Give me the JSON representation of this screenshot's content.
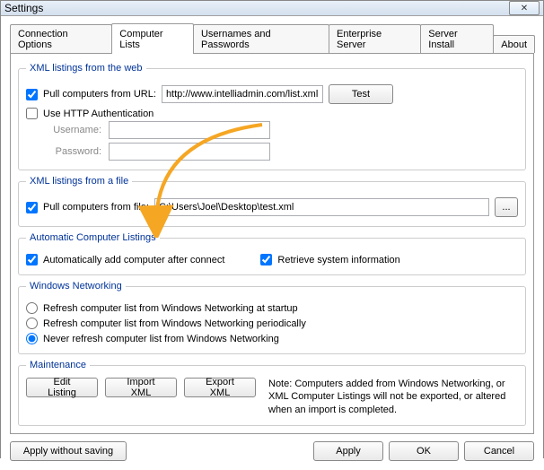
{
  "window": {
    "title": "Settings",
    "close_glyph": "✕"
  },
  "tabs": {
    "connection_options": "Connection Options",
    "computer_lists": "Computer Lists",
    "usernames_passwords": "Usernames and Passwords",
    "enterprise_server": "Enterprise Server",
    "server_install": "Server Install",
    "about": "About"
  },
  "web": {
    "legend": "XML listings from the web",
    "pull_label": "Pull computers from URL:",
    "url_value": "http://www.intelliadmin.com/list.xml",
    "test_label": "Test",
    "http_auth_label": "Use HTTP Authentication",
    "username_label": "Username:",
    "password_label": "Password:"
  },
  "file": {
    "legend": "XML listings from a file",
    "pull_label": "Pull computers from file:",
    "path_value": "C:\\Users\\Joel\\Desktop\\test.xml",
    "browse_label": "..."
  },
  "auto": {
    "legend": "Automatic Computer Listings",
    "add_label": "Automatically add computer after connect",
    "retrieve_label": "Retrieve system information"
  },
  "net": {
    "legend": "Windows Networking",
    "opt_startup": "Refresh computer list from Windows Networking at startup",
    "opt_periodic": "Refresh computer list from Windows Networking periodically",
    "opt_never": "Never refresh computer list from Windows Networking"
  },
  "maint": {
    "legend": "Maintenance",
    "edit_label": "Edit Listing",
    "import_label": "Import XML",
    "export_label": "Export XML",
    "note": "Note: Computers added from Windows Networking, or XML Computer Listings will not be exported, or altered when an import is completed."
  },
  "buttons": {
    "apply_without_saving": "Apply without saving",
    "apply": "Apply",
    "ok": "OK",
    "cancel": "Cancel"
  }
}
